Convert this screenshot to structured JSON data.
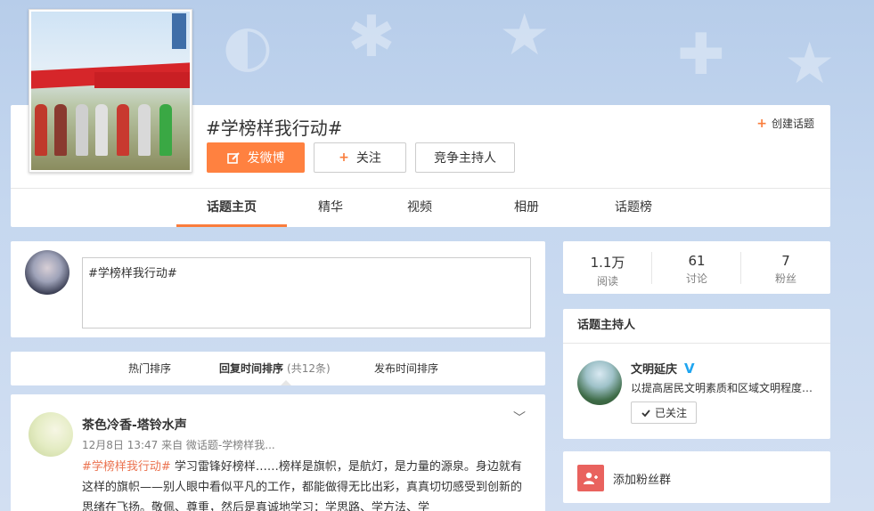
{
  "topic": {
    "title": "#学榜样我行动#",
    "create_label": "创建话题",
    "post_button": "发微博",
    "follow_button": "关注",
    "host_button": "竞争主持人"
  },
  "tabs": [
    {
      "label": "话题主页",
      "active": true
    },
    {
      "label": "精华",
      "active": false
    },
    {
      "label": "视频",
      "active": false
    },
    {
      "label": "相册",
      "active": false
    },
    {
      "label": "话题榜",
      "active": false
    }
  ],
  "composer": {
    "value": "#学榜样我行动#"
  },
  "sort": {
    "hot": "热门排序",
    "reply": "回复时间排序",
    "reply_count": "(共12条)",
    "publish": "发布时间排序"
  },
  "post": {
    "author": "茶色冷香-塔铃水声",
    "meta": "12月8日 13:47 来自 微话题-学榜样我...",
    "tag": "#学榜样我行动#",
    "text": " 学习雷锋好榜样……榜样是旗帜，是航灯，是力量的源泉。身边就有这样的旗帜——别人眼中看似平凡的工作，都能做得无比出彩，真真切切感受到创新的思绪在飞扬。敬佩、尊重，然后是真诚地学习：学思路、学方法、学"
  },
  "stats": [
    {
      "num": "1.1万",
      "label": "阅读"
    },
    {
      "num": "61",
      "label": "讨论"
    },
    {
      "num": "7",
      "label": "粉丝"
    }
  ],
  "host": {
    "title": "话题主持人",
    "name": "文明延庆",
    "verified": "V",
    "desc": "以提高居民文明素质和区域文明程度为目标",
    "followed_label": "已关注"
  },
  "fans": {
    "label": "添加粉丝群"
  },
  "colors": {
    "accent": "#ff8140",
    "tag": "#eb7350",
    "verified": "#1fa5f0"
  }
}
